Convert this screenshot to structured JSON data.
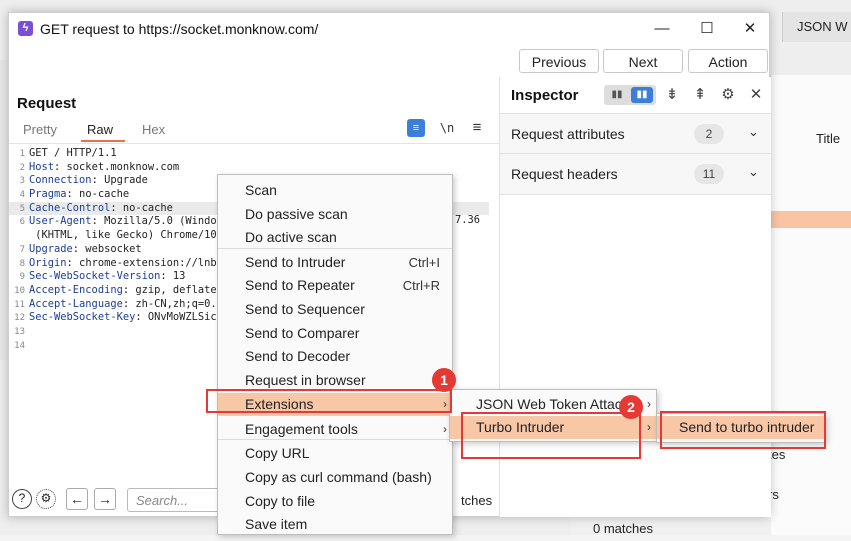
{
  "background": {
    "tab_json": "JSON W",
    "title_col": "Title",
    "frag_tes": "tes",
    "frag_rs": "rs",
    "matches": "0 matches"
  },
  "window": {
    "title": "GET request to https://socket.monknow.com/",
    "minimize_glyph": "—",
    "maximize_glyph": "☐",
    "close_glyph": "✕"
  },
  "toolbar": {
    "previous": "Previous",
    "next": "Next",
    "action": "Action"
  },
  "request": {
    "title": "Request",
    "tabs": [
      "Pretty",
      "Raw",
      "Hex"
    ],
    "active_tab": "Raw",
    "newline_toggle": "\\n",
    "lines": [
      {
        "n": "1",
        "key": "",
        "val": "GET / HTTP/1.1"
      },
      {
        "n": "2",
        "key": "Host",
        "val": ": socket.monknow.com"
      },
      {
        "n": "3",
        "key": "Connection",
        "val": ": Upgrade"
      },
      {
        "n": "4",
        "key": "Pragma",
        "val": ": no-cache"
      },
      {
        "n": "5",
        "key": "Cache-Control",
        "val": ": no-cache"
      },
      {
        "n": "6",
        "key": "User-Agent",
        "val": ": Mozilla/5.0 (Windo"
      },
      {
        "n": "",
        "key": "",
        "val": " (KHTML, like Gecko) Chrome/10"
      },
      {
        "n": "7",
        "key": "Upgrade",
        "val": ": websocket"
      },
      {
        "n": "8",
        "key": "Origin",
        "val": ": chrome-extension://lnb"
      },
      {
        "n": "9",
        "key": "Sec-WebSocket-Version",
        "val": ": 13"
      },
      {
        "n": "10",
        "key": "Accept-Encoding",
        "val": ": gzip, deflate"
      },
      {
        "n": "11",
        "key": "Accept-Language",
        "val": ": zh-CN,zh;q=0."
      },
      {
        "n": "12",
        "key": "Sec-WebSocket-Key",
        "val": ": ONvMoWZLSic"
      },
      {
        "n": "13",
        "key": "",
        "val": ""
      },
      {
        "n": "14",
        "key": "",
        "val": ""
      }
    ],
    "line6_tail": "7.36",
    "search_placeholder": "Search...",
    "matches_tail": "tches"
  },
  "inspector": {
    "title": "Inspector",
    "rows": [
      {
        "label": "Request attributes",
        "count": "2"
      },
      {
        "label": "Request headers",
        "count": "11"
      }
    ]
  },
  "context_menu": {
    "items": [
      {
        "label": "Scan",
        "shortcut": ""
      },
      {
        "label": "Do passive scan",
        "shortcut": ""
      },
      {
        "label": "Do active scan",
        "shortcut": ""
      },
      {
        "label": "Send to Intruder",
        "shortcut": "Ctrl+I"
      },
      {
        "label": "Send to Repeater",
        "shortcut": "Ctrl+R"
      },
      {
        "label": "Send to Sequencer",
        "shortcut": ""
      },
      {
        "label": "Send to Comparer",
        "shortcut": ""
      },
      {
        "label": "Send to Decoder",
        "shortcut": ""
      },
      {
        "label": "Request in browser",
        "shortcut": ""
      },
      {
        "label": "Extensions",
        "shortcut": ""
      },
      {
        "label": "Engagement tools",
        "shortcut": ""
      },
      {
        "label": "Copy URL",
        "shortcut": ""
      },
      {
        "label": "Copy as curl command (bash)",
        "shortcut": ""
      },
      {
        "label": "Copy to file",
        "shortcut": ""
      },
      {
        "label": "Save item",
        "shortcut": ""
      }
    ],
    "submenu_arrow": "›"
  },
  "extensions_submenu": {
    "items": [
      "JSON Web Token Attack",
      "Turbo Intruder"
    ]
  },
  "turbo_submenu": {
    "items": [
      "Send to turbo intruder"
    ]
  },
  "annotations": {
    "badge1": "1",
    "badge2": "2",
    "highlight_color": "#e53935"
  },
  "colors": {
    "accent_orange": "#e8734a",
    "selection": "#f8c7a6",
    "header_key_blue": "#1a3f9a",
    "toggle_blue": "#3c7fd8"
  }
}
